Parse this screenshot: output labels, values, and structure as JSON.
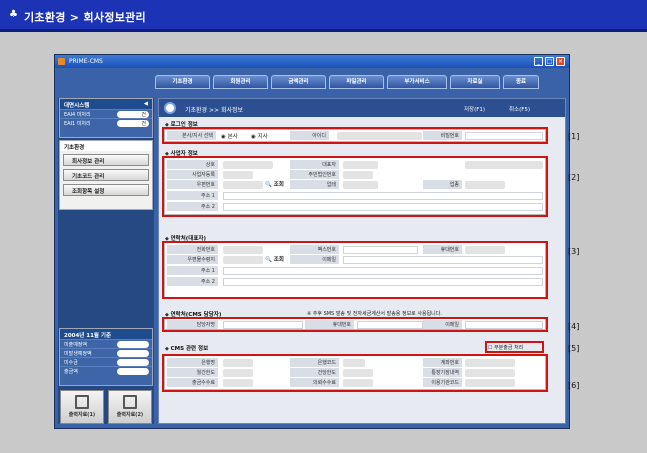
{
  "header": {
    "title": "기초환경 > 회사정보관리",
    "icon": "club-icon"
  },
  "window": {
    "title": "PRIME-CMS"
  },
  "menu": {
    "tabs": [
      "기초환경",
      "회원관리",
      "금액관리",
      "파일관리",
      "부가서비스",
      "자료실",
      "종료"
    ]
  },
  "sidebar": {
    "system": {
      "title": "대면시스템",
      "rows": [
        {
          "label": "EAI4 미처리",
          "value": "건"
        },
        {
          "label": "EAI1 미처리",
          "value": "건"
        }
      ]
    },
    "env": {
      "title": "기초환경",
      "buttons": [
        "회사정보 관리",
        "기초코드 관리",
        "조회항목 설정"
      ]
    },
    "stats": {
      "title": "2004년 11월 기준",
      "rows": [
        "미출예정액",
        "미발생예정액",
        "미수금",
        "출금액"
      ]
    },
    "print_buttons": [
      "출력자료(1)",
      "출력자료(2)"
    ]
  },
  "main": {
    "breadcrumb": "기초환경 >> 회사정보",
    "actions": {
      "save": "저장(F1)",
      "cancel": "취소(F5)"
    },
    "s1": {
      "title": "로그인 정보",
      "select_label": "본사/지사 선택",
      "radio_hq": "본사",
      "radio_branch": "지사",
      "id_label": "아이디",
      "pw_label": "비밀번호",
      "callout": "[1]"
    },
    "s2": {
      "title": "사업자 정보",
      "labels": [
        "상호",
        "대표자",
        "사업자등록",
        "주민법인번호",
        "우편번호",
        "업태",
        "업종",
        "주소 1",
        "주소 2"
      ],
      "search": "조회",
      "callout": "[2]"
    },
    "s3": {
      "title": "연락처(대표자)",
      "labels": [
        "전화번호",
        "팩스번호",
        "휴대번호",
        "우편물수령지",
        "이메일",
        "주소 1",
        "주소 2"
      ],
      "search": "조회",
      "callout": "[3]"
    },
    "s4": {
      "title": "연락처(CMS 담당자)",
      "note": "※ 추후 SMS 발송 및 전자세금계산서 발송용 정보로 사용됩니다.",
      "labels": [
        "담당자명",
        "휴대번호",
        "이메일"
      ],
      "callout": "[4]"
    },
    "s5": {
      "checkbox": "부분출금 처리",
      "callout": "[5]"
    },
    "s6": {
      "title": "CMS 관련 정보",
      "labels": [
        "은행명",
        "은행코드",
        "계좌번호",
        "월간한도",
        "건당한도",
        "통장기장내역",
        "출금수수료",
        "의뢰수수료",
        "이용기관코드"
      ],
      "callout": "[6]"
    }
  }
}
